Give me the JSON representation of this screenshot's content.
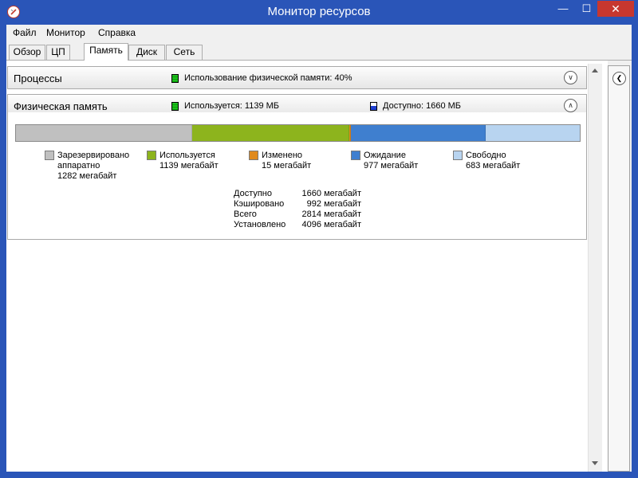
{
  "window": {
    "title": "Монитор ресурсов",
    "min": "—",
    "max": "☐",
    "close": "✕"
  },
  "menu": [
    "Файл",
    "Монитор",
    "Справка"
  ],
  "tabs": [
    "Обзор",
    "ЦП",
    "Память",
    "Диск",
    "Сеть"
  ],
  "active_tab": "Память",
  "processes": {
    "title": "Процессы",
    "status": "Использование физической памяти: 40%"
  },
  "physical": {
    "title": "Физическая память",
    "used": "Используется: 1139 МБ",
    "available": "Доступно: 1660 МБ"
  },
  "memory_bar": [
    {
      "name": "hardware-reserved",
      "mb": 1282,
      "color": "#c0c0c0"
    },
    {
      "name": "in-use",
      "mb": 1139,
      "color": "#8db41d"
    },
    {
      "name": "modified",
      "mb": 15,
      "color": "#e08a1e"
    },
    {
      "name": "standby",
      "mb": 977,
      "color": "#3f7fcf"
    },
    {
      "name": "free",
      "mb": 683,
      "color": "#b8d4f0"
    }
  ],
  "legend": [
    {
      "line1": "Зарезервировано",
      "line2": "аппаратно",
      "line3": "1282 мегабайт",
      "color": "#c0c0c0"
    },
    {
      "line1": "Используется",
      "line2": "1139 мегабайт",
      "line3": "",
      "color": "#8db41d"
    },
    {
      "line1": "Изменено",
      "line2": "15 мегабайт",
      "line3": "",
      "color": "#e08a1e"
    },
    {
      "line1": "Ожидание",
      "line2": "977 мегабайт",
      "line3": "",
      "color": "#3f7fcf"
    },
    {
      "line1": "Свободно",
      "line2": "683 мегабайт",
      "line3": "",
      "color": "#b8d4f0"
    }
  ],
  "stats": [
    {
      "label": "Доступно",
      "value": "1660 мегабайт"
    },
    {
      "label": "Кэшировано",
      "value": "992 мегабайт"
    },
    {
      "label": "Всего",
      "value": "2814 мегабайт"
    },
    {
      "label": "Установлено",
      "value": "4096 мегабайт"
    }
  ],
  "colors": {
    "titlebar": "#2a55b8",
    "close": "#c7372f"
  }
}
